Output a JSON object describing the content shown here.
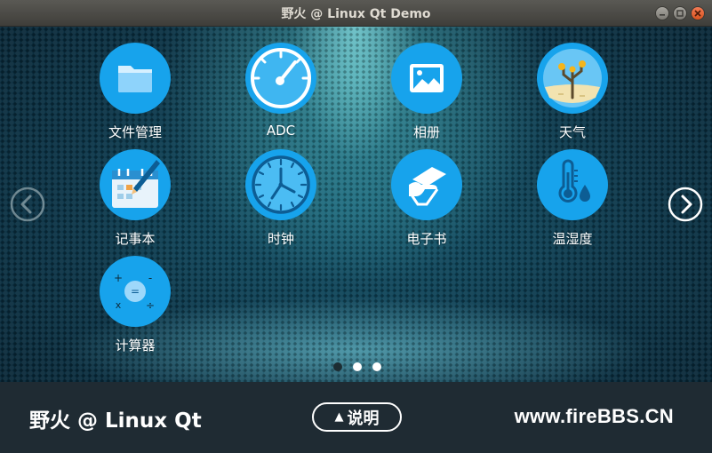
{
  "window": {
    "title": "野火 @ Linux Qt Demo",
    "controls": [
      "minimize",
      "maximize",
      "close"
    ]
  },
  "apps": [
    {
      "label": "文件管理",
      "icon": "folder-icon"
    },
    {
      "label": "ADC",
      "icon": "gauge-icon"
    },
    {
      "label": "相册",
      "icon": "photo-icon"
    },
    {
      "label": "天气",
      "icon": "weather-icon"
    },
    {
      "label": "记事本",
      "icon": "notepad-icon"
    },
    {
      "label": "时钟",
      "icon": "clock-icon"
    },
    {
      "label": "电子书",
      "icon": "ebook-icon"
    },
    {
      "label": "温湿度",
      "icon": "thermometer-icon"
    },
    {
      "label": "计算器",
      "icon": "calculator-icon"
    }
  ],
  "pager": {
    "pages": 3,
    "current": 1
  },
  "footer": {
    "left_text": "野火 @ Linux Qt",
    "help_label": "说明",
    "help_icon": "triangle-up-icon",
    "right_text": "www.fireBBS.CN"
  },
  "colors": {
    "icon_blue": "#1aa0e8",
    "footer_bg": "#1f2b33"
  }
}
